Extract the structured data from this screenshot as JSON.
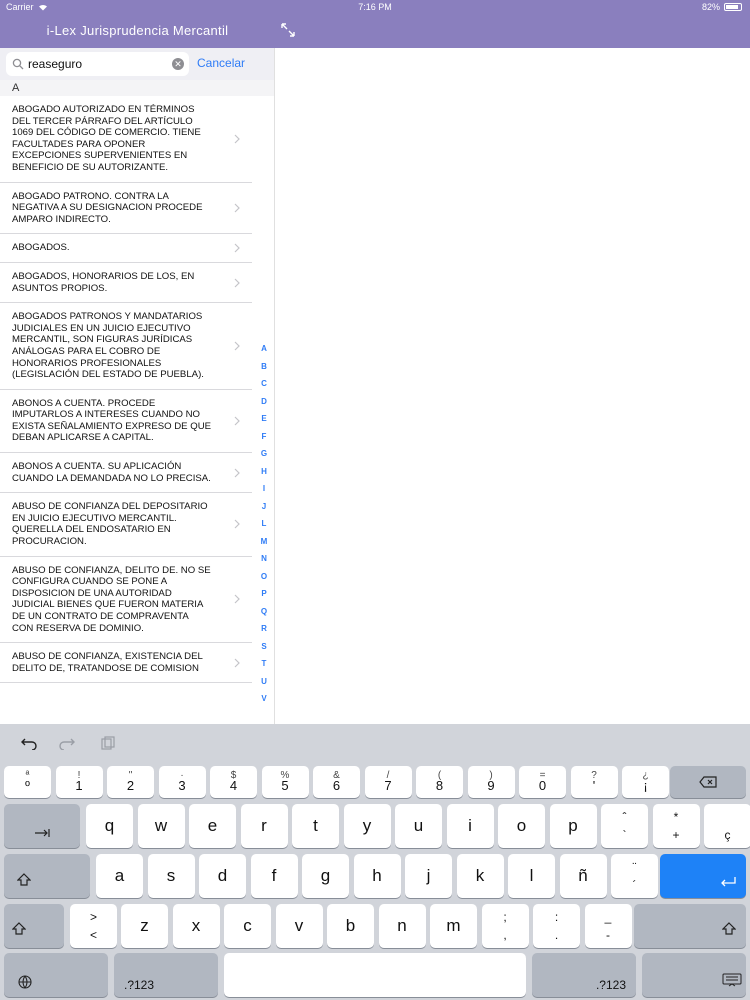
{
  "status_bar": {
    "carrier": "Carrier",
    "time": "7:16 PM",
    "battery": "82%"
  },
  "nav": {
    "title": "i-Lex Jurisprudencia Mercantil"
  },
  "search": {
    "value": "reaseguro",
    "cancel_label": "Cancelar"
  },
  "section": "A",
  "items": [
    "ABOGADO AUTORIZADO EN TÉRMINOS DEL TERCER PÁRRAFO DEL ARTÍCULO 1069 DEL CÓDIGO DE COMERCIO. TIENE FACULTADES PARA OPONER EXCEPCIONES SUPERVENIENTES EN BENEFICIO DE SU AUTORIZANTE.",
    "ABOGADO PATRONO. CONTRA LA NEGATIVA A SU DESIGNACION PROCEDE AMPARO INDIRECTO.",
    "ABOGADOS.",
    "ABOGADOS, HONORARIOS DE LOS, EN ASUNTOS PROPIOS.",
    "ABOGADOS PATRONOS Y MANDATARIOS JUDICIALES EN UN JUICIO EJECUTIVO MERCANTIL, SON FIGURAS JURÍDICAS ANÁLOGAS PARA EL COBRO DE HONORARIOS PROFESIONALES (LEGISLACIÓN DEL ESTADO DE PUEBLA).",
    "ABONOS A CUENTA. PROCEDE IMPUTARLOS A INTERESES CUANDO NO EXISTA SEÑALAMIENTO EXPRESO DE QUE DEBAN APLICARSE A CAPITAL.",
    "ABONOS A CUENTA. SU APLICACIÓN CUANDO LA DEMANDADA NO LO PRECISA.",
    "ABUSO DE CONFIANZA DEL DEPOSITARIO EN JUICIO EJECUTIVO MERCANTIL. QUERELLA DEL ENDOSATARIO EN PROCURACION.",
    "ABUSO DE CONFIANZA, DELITO DE. NO SE CONFIGURA CUANDO SE PONE A DISPOSICION DE UNA AUTORIDAD JUDICIAL BIENES QUE FUERON MATERIA DE UN CONTRATO DE COMPRAVENTA CON RESERVA DE DOMINIO.",
    "ABUSO DE CONFIANZA, EXISTENCIA DEL DELITO DE, TRATANDOSE DE COMISION"
  ],
  "index_letters": [
    "A",
    "B",
    "C",
    "D",
    "E",
    "F",
    "G",
    "H",
    "I",
    "J",
    "L",
    "M",
    "N",
    "O",
    "P",
    "Q",
    "R",
    "S",
    "T",
    "U",
    "V"
  ],
  "keyboard": {
    "row1": [
      {
        "sub": "ª",
        "main": "º"
      },
      {
        "sub": "!",
        "main": "1"
      },
      {
        "sub": "\"",
        "main": "2"
      },
      {
        "sub": "·",
        "main": "3"
      },
      {
        "sub": "$",
        "main": "4"
      },
      {
        "sub": "%",
        "main": "5"
      },
      {
        "sub": "&",
        "main": "6"
      },
      {
        "sub": "/",
        "main": "7"
      },
      {
        "sub": "(",
        "main": "8"
      },
      {
        "sub": ")",
        "main": "9"
      },
      {
        "sub": "=",
        "main": "0"
      },
      {
        "sub": "?",
        "main": "'"
      },
      {
        "sub": "¿",
        "main": "¡"
      }
    ],
    "row2": [
      "q",
      "w",
      "e",
      "r",
      "t",
      "y",
      "u",
      "i",
      "o",
      "p"
    ],
    "row2_extra": [
      {
        "top": "ˆ",
        "bottom": "`"
      },
      {
        "top": "*",
        "bottom": "+"
      },
      {
        "top": "",
        "bottom": "ç"
      }
    ],
    "row3": [
      "a",
      "s",
      "d",
      "f",
      "g",
      "h",
      "j",
      "k",
      "l",
      "ñ"
    ],
    "row3_extra": {
      "top": "¨",
      "bottom": "´"
    },
    "row4_first": {
      "top": ">",
      "bottom": "<"
    },
    "row4": [
      "z",
      "x",
      "c",
      "v",
      "b",
      "n",
      "m"
    ],
    "row4_extra": [
      {
        "top": ";",
        "bottom": ","
      },
      {
        "top": ":",
        "bottom": "."
      },
      {
        "top": "_",
        "bottom": "-"
      }
    ],
    "numbers_label": ".?123"
  }
}
